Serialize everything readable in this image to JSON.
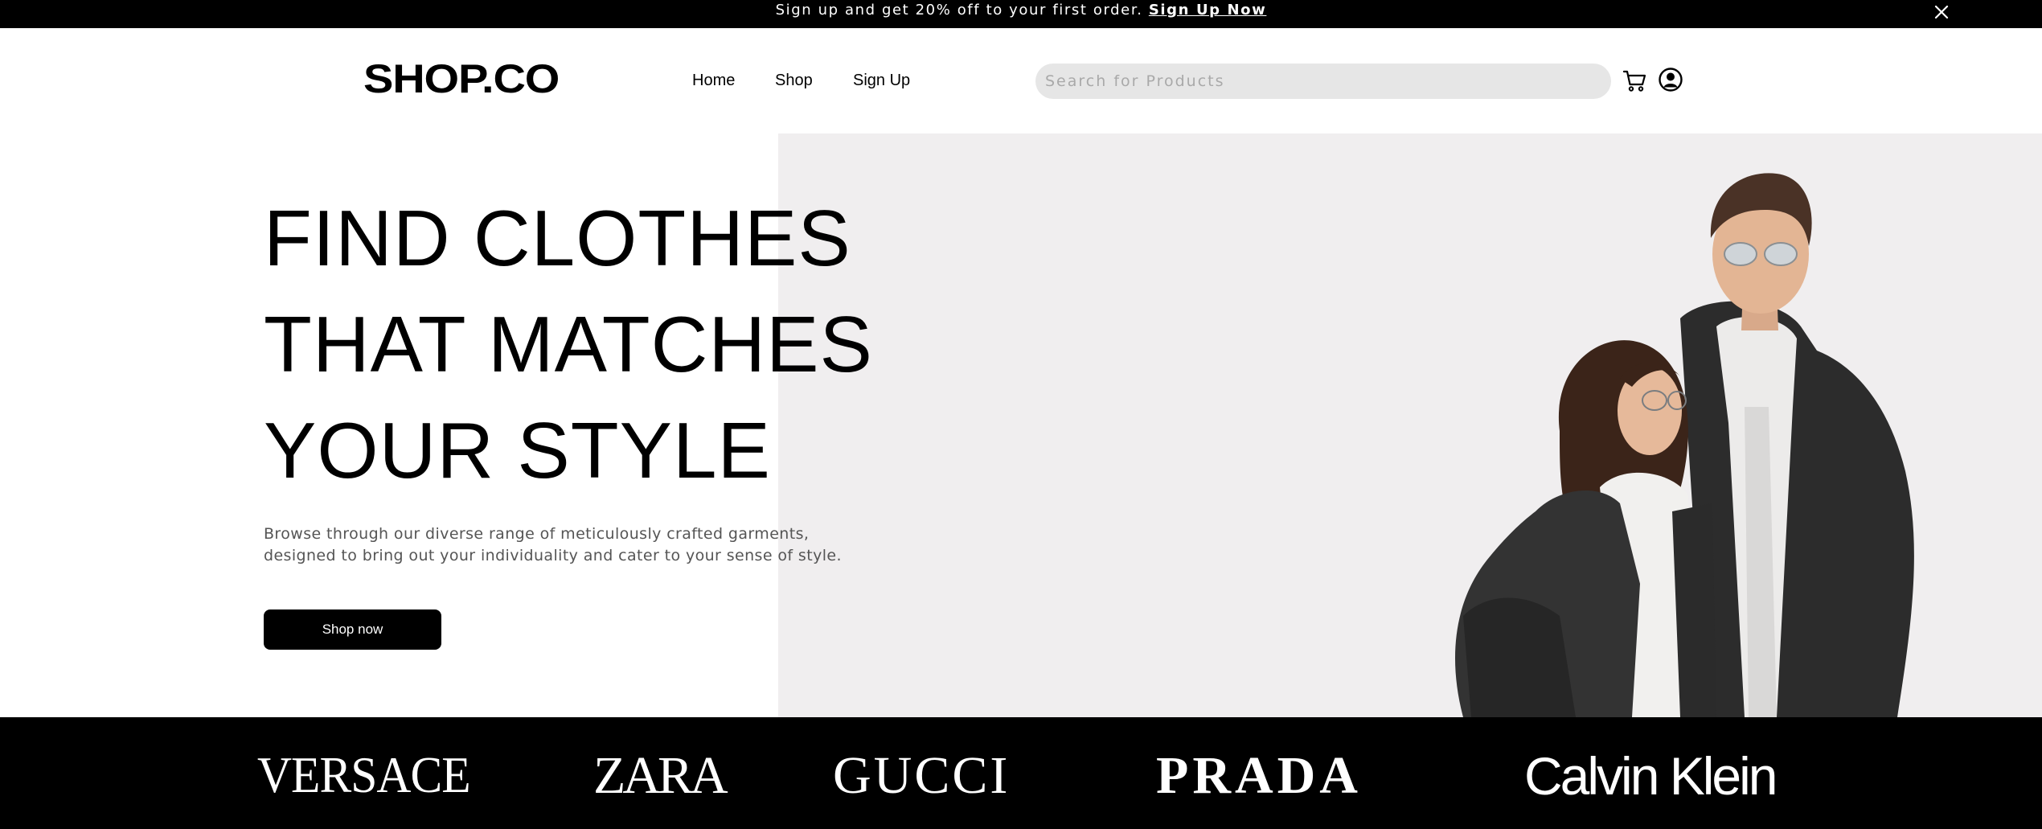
{
  "announcement": {
    "text": "Sign up and get 20% off to your first order.",
    "link_label": "Sign Up Now",
    "close_icon": "close-icon"
  },
  "header": {
    "logo": "SHOP.CO",
    "nav": [
      "Home",
      "Shop",
      "Sign Up"
    ],
    "search": {
      "value": "",
      "placeholder": "Search for Products"
    },
    "icons": [
      "cart-icon",
      "user-icon"
    ]
  },
  "hero": {
    "title_lines": [
      "FIND CLOTHES",
      "THAT MATCHES",
      "YOUR STYLE"
    ],
    "description": "Browse through our diverse range of meticulously crafted garments, designed to bring out your individuality and cater to your sense of style.",
    "cta_label": "Shop now",
    "image": "models-photo",
    "colors": {
      "hero_panel": "#f0eeef",
      "cta_bg": "#000000"
    }
  },
  "brands": [
    "VERSACE",
    "ZARA",
    "GUCCI",
    "PRADA",
    "Calvin Klein"
  ]
}
